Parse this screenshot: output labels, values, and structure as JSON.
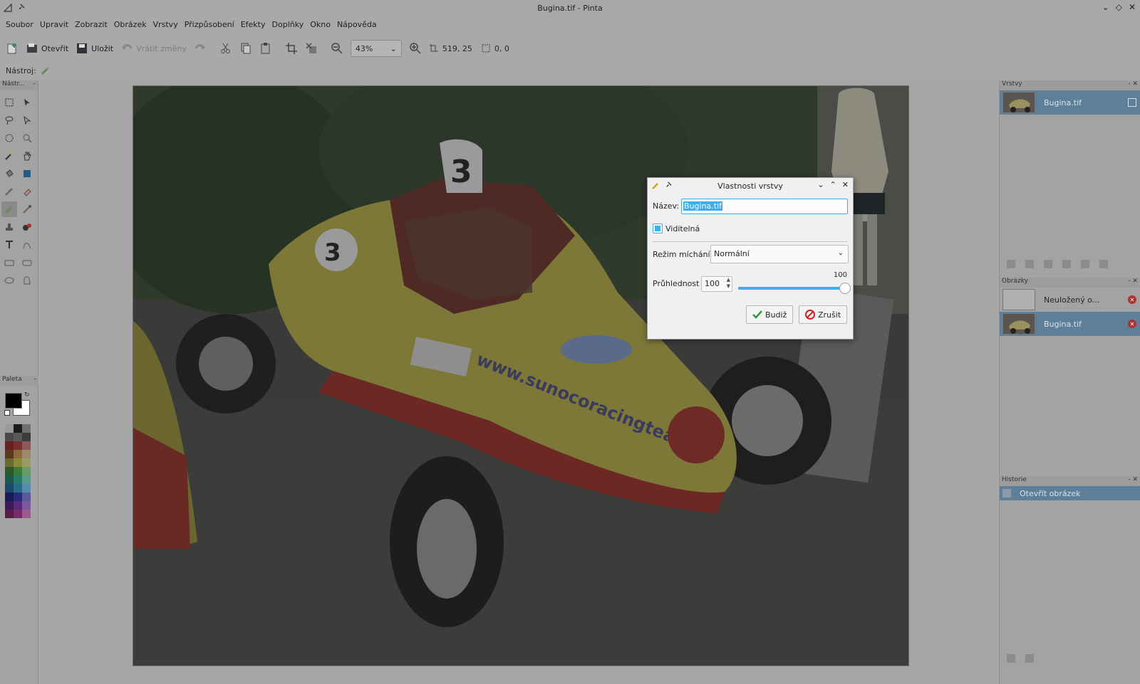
{
  "window": {
    "title": "Bugina.tif - Pinta"
  },
  "menu": [
    "Soubor",
    "Upravit",
    "Zobrazit",
    "Obrázek",
    "Vrstvy",
    "Přizpůsobení",
    "Efekty",
    "Doplňky",
    "Okno",
    "Nápověda"
  ],
  "toolbar": {
    "open_label": "Otevřít",
    "save_label": "Uložit",
    "undo_label": "Vrátit změny",
    "zoom_value": "43%",
    "image_size": "519, 25",
    "cursor_pos": "0, 0"
  },
  "tool_row": {
    "label": "Nástroj:"
  },
  "left_panel": {
    "tools_title": "Nástr...",
    "palette_title": "Paleta"
  },
  "layers_panel": {
    "title": "Vrstvy",
    "layers": [
      {
        "name": "Bugina.tif"
      }
    ]
  },
  "images_panel": {
    "title": "Obrázky",
    "items": [
      {
        "name": "Neuložený o..."
      },
      {
        "name": "Bugina.tif"
      }
    ]
  },
  "history_panel": {
    "title": "Historie",
    "items": [
      {
        "name": "Otevřít obrázek"
      }
    ]
  },
  "dialog": {
    "title": "Vlastnosti vrstvy",
    "name_label": "Název:",
    "name_value": "Bugina.tif",
    "visible_label": "Viditelná",
    "visible_checked": true,
    "blend_label": "Režim míchání:",
    "blend_value": "Normální",
    "opacity_label": "Průhlednost",
    "opacity_value": "100",
    "opacity_slider_max": "100",
    "opacity_fraction": 1.0,
    "ok_label": "Budiž",
    "cancel_label": "Zrušit"
  },
  "colors": {
    "accent": "#3daee9",
    "selection": "#5d7f99",
    "primary_color": "#000000",
    "secondary_color": "#ffffff"
  }
}
